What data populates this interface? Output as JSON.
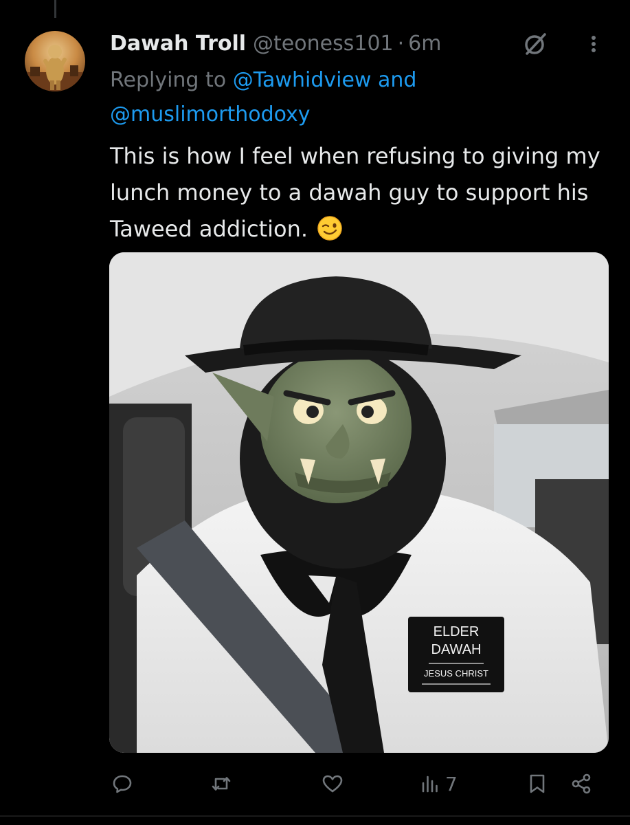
{
  "tweet": {
    "display_name": "Dawah Troll",
    "handle": "@teoness101",
    "separator": "·",
    "time": "6m",
    "replying_prefix": "Replying to",
    "reply_mention_1": "@Tawhidview",
    "reply_conjunction": "and",
    "reply_mention_2": "@muslimorthodoxy",
    "text": "This is how I feel when refusing to giving my lunch money to a dawah guy to support his Taweed addiction.",
    "emoji": "winking-face"
  },
  "media": {
    "badge_line_1": "ELDER",
    "badge_line_2": "DAWAH",
    "badge_line_3": "JESUS CHRIST"
  },
  "actions": {
    "reply_icon": "reply-icon",
    "repost_icon": "repost-icon",
    "like_icon": "heart-icon",
    "views_icon": "views-icon",
    "views_count": "7",
    "bookmark_icon": "bookmark-icon",
    "share_icon": "share-icon"
  },
  "colors": {
    "background": "#000000",
    "text_primary": "#e7e9ea",
    "text_secondary": "#71767b",
    "link": "#1d9bf0"
  }
}
